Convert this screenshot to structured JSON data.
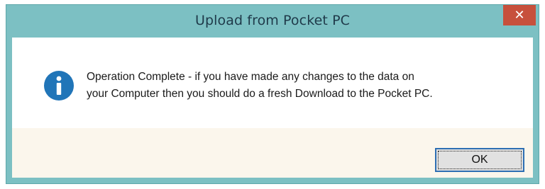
{
  "dialog": {
    "title": "Upload from Pocket PC",
    "close_glyph": "✕",
    "message_line1": "Operation Complete - if you have made any changes to the data on",
    "message_line2": "your Computer then you should do a fresh Download to the Pocket PC.",
    "ok_label": "OK",
    "icon": "info-icon"
  },
  "colors": {
    "frame": "#7cc0c3",
    "close_button": "#c7503c",
    "icon_fill": "#2175b8",
    "footer": "#fbf6ec",
    "ok_border": "#2e6fb3"
  }
}
